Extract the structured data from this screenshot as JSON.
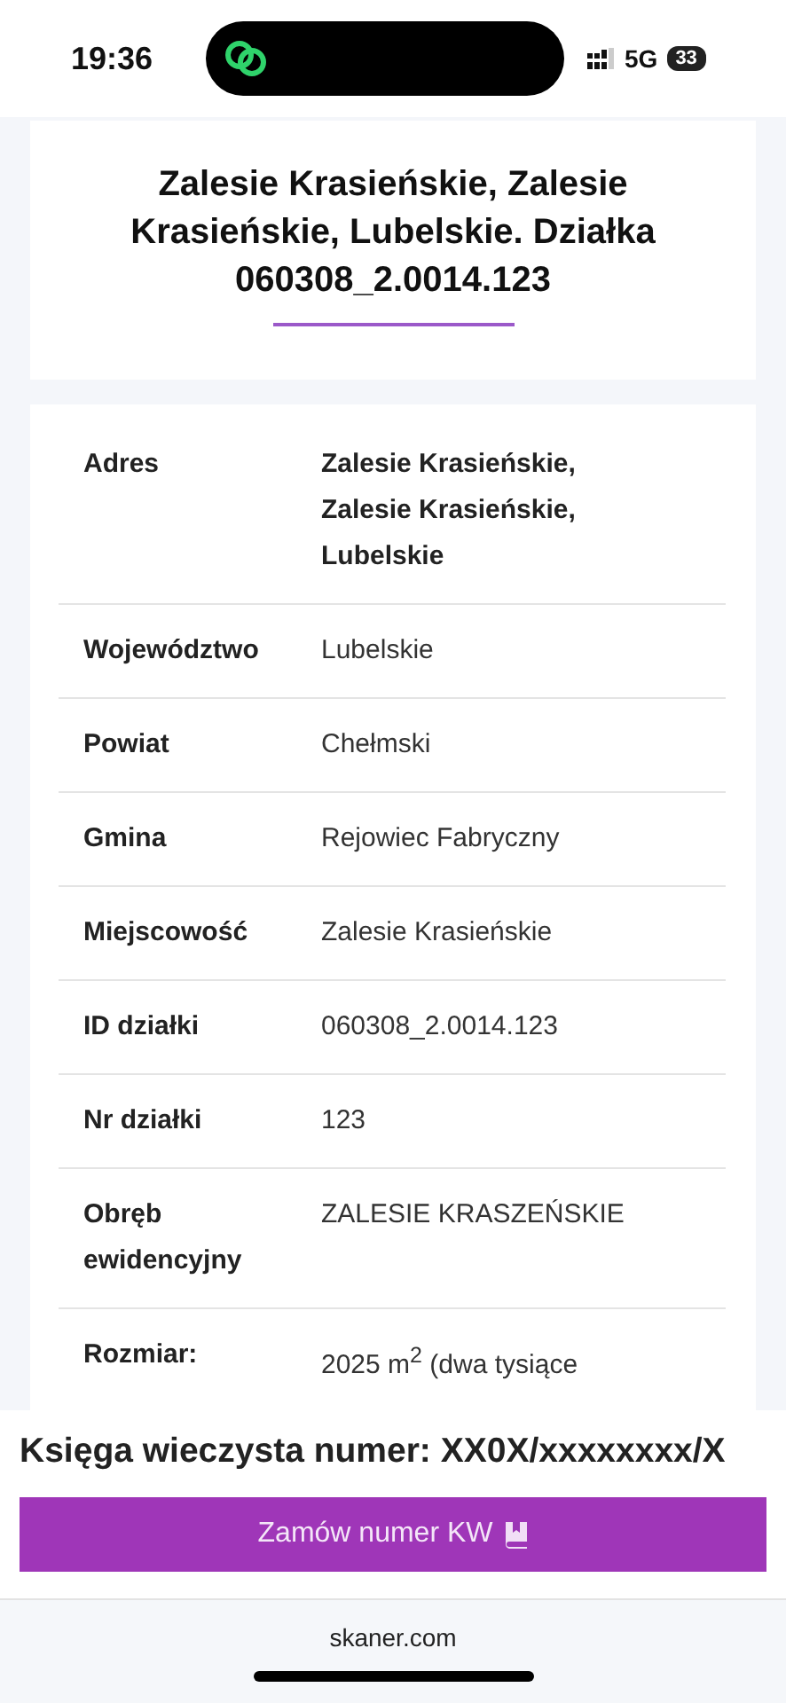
{
  "status_bar": {
    "time": "19:36",
    "network": "5G",
    "battery": "33"
  },
  "title": "Zalesie Krasieńskie, Zalesie Krasieńskie, Lubelskie. Działka 060308_2.0014.123",
  "details": [
    {
      "label": "Adres",
      "value": "Zalesie Krasieńskie, Zalesie Krasieńskie, Lubelskie",
      "bold": true
    },
    {
      "label": "Województwo",
      "value": "Lubelskie",
      "bold": false
    },
    {
      "label": "Powiat",
      "value": "Chełmski",
      "bold": false
    },
    {
      "label": "Gmina",
      "value": "Rejowiec Fabryczny",
      "bold": false
    },
    {
      "label": "Miejscowość",
      "value": "Zalesie Krasieńskie",
      "bold": false
    },
    {
      "label": "ID działki",
      "value": "060308_2.0014.123",
      "bold": false
    },
    {
      "label": "Nr działki",
      "value": "123",
      "bold": false
    },
    {
      "label": "Obręb ewidencyjny",
      "value": "ZALESIE KRASZEŃSKIE",
      "bold": false
    },
    {
      "label": "Rozmiar:",
      "value": "2025 m$^{2}$ (dwa tysiące",
      "bold": false
    }
  ],
  "land_registry": {
    "heading": "Księga wieczysta numer: XX0X/xxxxxxxx/X",
    "button": "Zamów numer KW"
  },
  "browser": {
    "url": "skaner.com"
  }
}
